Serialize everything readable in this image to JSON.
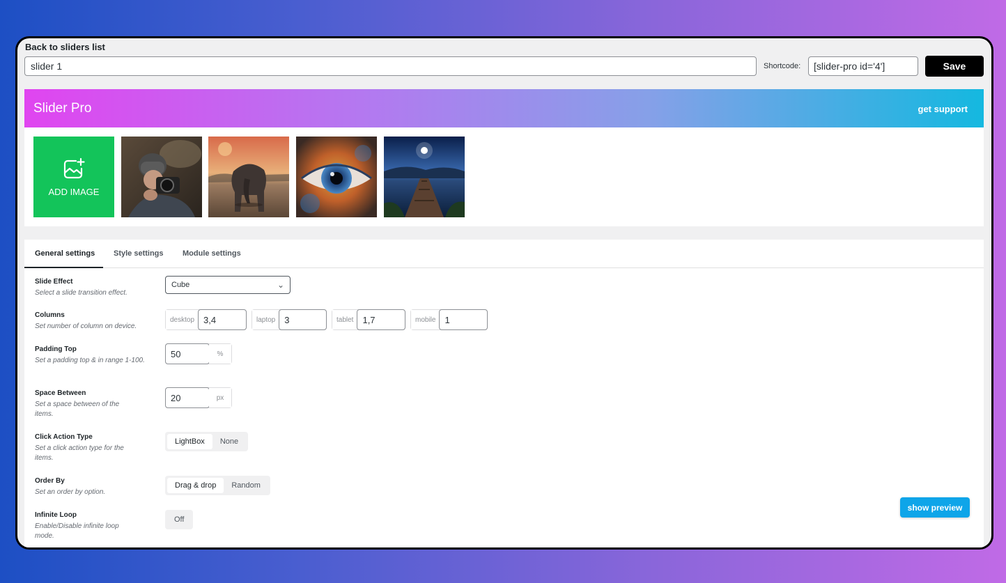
{
  "header": {
    "back_link": "Back to sliders list",
    "slider_name": "slider 1",
    "shortcode_label": "Shortcode:",
    "shortcode_value": "[slider-pro id='4']",
    "save_label": "Save"
  },
  "banner": {
    "title": "Slider Pro",
    "support_link": "get support"
  },
  "gallery": {
    "add_image_label": "ADD IMAGE",
    "thumbnails": [
      "photographer-image",
      "elephant-image",
      "eye-image",
      "lake-pier-image"
    ]
  },
  "tabs": [
    {
      "label": "General settings",
      "active": true
    },
    {
      "label": "Style settings",
      "active": false
    },
    {
      "label": "Module settings",
      "active": false
    }
  ],
  "settings": {
    "slide_effect": {
      "title": "Slide Effect",
      "desc": "Select a slide transition effect.",
      "value": "Cube"
    },
    "columns": {
      "title": "Columns",
      "desc": "Set number of column on device.",
      "devices": [
        {
          "label": "desktop",
          "value": "3,4"
        },
        {
          "label": "laptop",
          "value": "3"
        },
        {
          "label": "tablet",
          "value": "1,7"
        },
        {
          "label": "mobile",
          "value": "1"
        }
      ]
    },
    "padding_top": {
      "title": "Padding Top",
      "desc": "Set a padding top & in range 1-100.",
      "value": "50",
      "unit": "%"
    },
    "space_between": {
      "title": "Space Between",
      "desc": "Set a space between of the items.",
      "value": "20",
      "unit": "px"
    },
    "click_action": {
      "title": "Click Action Type",
      "desc": "Set a click action type for the items.",
      "options": [
        "LightBox",
        "None"
      ],
      "selected": "LightBox"
    },
    "order_by": {
      "title": "Order By",
      "desc": "Set an order by option.",
      "options": [
        "Drag & drop",
        "Random"
      ],
      "selected": "Drag & drop"
    },
    "infinite_loop": {
      "title": "Infinite Loop",
      "desc": "Enable/Disable infinite loop mode.",
      "value": "Off"
    }
  },
  "preview_label": "show preview",
  "colors": {
    "accent_green": "#13c45a",
    "preview_blue": "#0ea5e9",
    "save_black": "#000000"
  }
}
